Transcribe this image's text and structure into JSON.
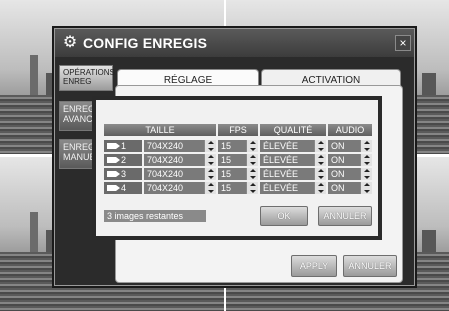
{
  "dialog": {
    "title": "CONFIG ENREGIS",
    "close_label": "×",
    "sidebar": [
      {
        "label": "OPÉRATIONS ENREG"
      },
      {
        "label": "ENREG AVANCÉ"
      },
      {
        "label": "ENREG MANUEL"
      }
    ],
    "tabs": [
      {
        "label": "RÉGLAGE"
      },
      {
        "label": "ACTIVATION"
      }
    ],
    "apply_label": "APPLY",
    "cancel_label": "ANNULER"
  },
  "popup": {
    "headers": [
      "TAILLE",
      "FPS",
      "QUALITÉ",
      "AUDIO"
    ],
    "rows": [
      {
        "camera": "1",
        "size": "704X240",
        "fps": "15",
        "quality": "ÉLEVÉE",
        "audio": "ON"
      },
      {
        "camera": "2",
        "size": "704X240",
        "fps": "15",
        "quality": "ÉLEVÉE",
        "audio": "ON"
      },
      {
        "camera": "3",
        "size": "704X240",
        "fps": "15",
        "quality": "ÉLEVÉE",
        "audio": "ON"
      },
      {
        "camera": "4",
        "size": "704X240",
        "fps": "15",
        "quality": "ÉLEVÉE",
        "audio": "ON"
      }
    ],
    "status_text": "3 images restantes",
    "ok_label": "OK",
    "cancel_label": "ANNULER"
  },
  "colors": {
    "dialog_bg": "#2b2b2b",
    "panel_bg": "#f3f3f3",
    "header_bg": "#6e6e6e",
    "value_cell_bg": "#7a7a7a"
  },
  "icons": {
    "title": "gear-icon",
    "close": "close-icon",
    "camera": "camera-icon",
    "spinner": "spinner-arrows-icon"
  }
}
